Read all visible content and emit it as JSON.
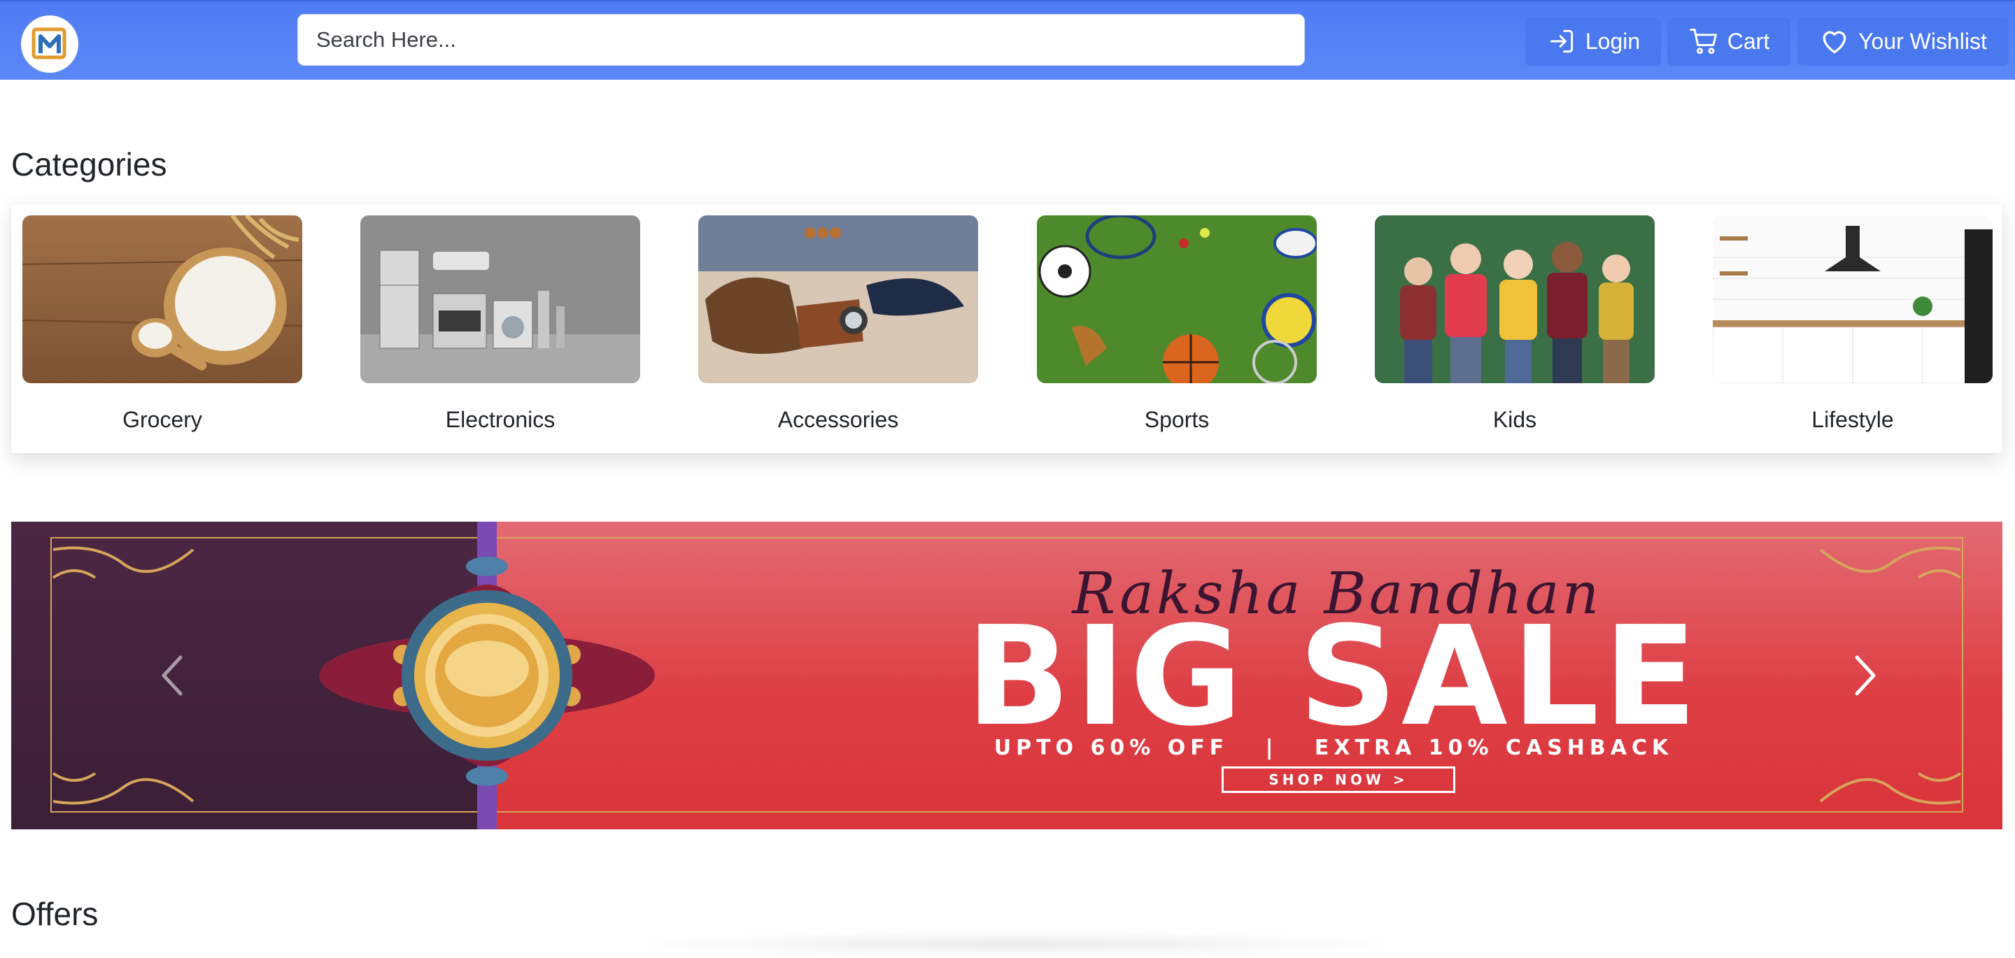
{
  "header": {
    "logo_icon": "m-logo-icon",
    "search_placeholder": "Search Here...",
    "login_label": "Login",
    "cart_label": "Cart",
    "wishlist_label": "Your Wishlist",
    "colors": {
      "navbar": "#5b87f7",
      "button": "#4a78ee"
    }
  },
  "categories": {
    "title": "Categories",
    "items": [
      {
        "label": "Grocery"
      },
      {
        "label": "Electronics"
      },
      {
        "label": "Accessories"
      },
      {
        "label": "Sports"
      },
      {
        "label": "Kids"
      },
      {
        "label": "Lifestyle"
      }
    ]
  },
  "banner": {
    "script_title": "Raksha Bandhan",
    "headline": "BIG SALE",
    "offer_line": "UPTO 60% OFF   |   EXTRA 10% CASHBACK",
    "cta": "SHOP NOW >",
    "prev_icon": "chevron-left-icon",
    "next_icon": "chevron-right-icon",
    "colors": {
      "left_panel": "#3a1f36",
      "right_panel": "#dd3f45",
      "gold": "#d6a45a"
    }
  },
  "offers": {
    "title": "Offers"
  }
}
